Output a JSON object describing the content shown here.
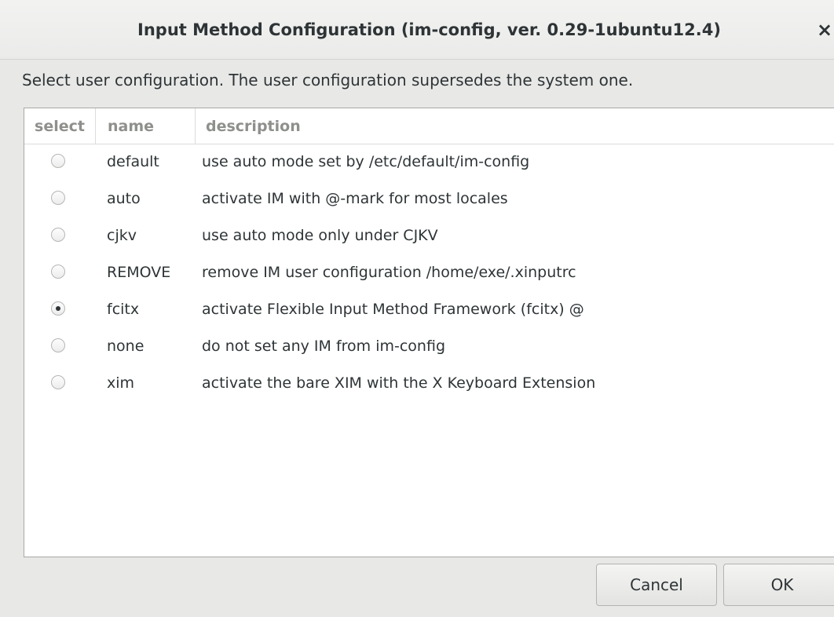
{
  "window": {
    "title": "Input Method Configuration (im-config, ver. 0.29-1ubuntu12.4)",
    "close_glyph": "×"
  },
  "prompt": "Select user configuration. The user configuration supersedes the system one.",
  "table": {
    "columns": [
      "select",
      "name",
      "description"
    ],
    "rows": [
      {
        "name": "default",
        "description": "use auto mode set by /etc/default/im-config",
        "selected": false
      },
      {
        "name": "auto",
        "description": "activate IM with @-mark for most locales",
        "selected": false
      },
      {
        "name": "cjkv",
        "description": "use auto mode only under CJKV",
        "selected": false
      },
      {
        "name": "REMOVE",
        "description": "remove IM user configuration /home/exe/.xinputrc",
        "selected": false
      },
      {
        "name": "fcitx",
        "description": "activate Flexible Input Method Framework (fcitx) @",
        "selected": true
      },
      {
        "name": "none",
        "description": "do not set any IM from im-config",
        "selected": false
      },
      {
        "name": "xim",
        "description": "activate the bare XIM with the X Keyboard Extension",
        "selected": false
      }
    ]
  },
  "buttons": {
    "cancel": "Cancel",
    "ok": "OK"
  },
  "icons": {
    "close": "close-icon",
    "radio": "radio-button"
  }
}
